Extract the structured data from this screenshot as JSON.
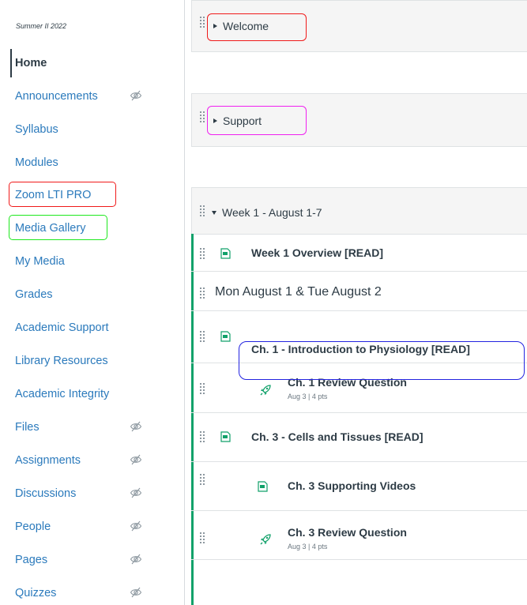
{
  "nav": {
    "term": "Summer II 2022",
    "items": [
      {
        "label": "Home",
        "active": true,
        "hidden": false
      },
      {
        "label": "Announcements",
        "active": false,
        "hidden": true
      },
      {
        "label": "Syllabus",
        "active": false,
        "hidden": false
      },
      {
        "label": "Modules",
        "active": false,
        "hidden": false
      },
      {
        "label": "Zoom LTI PRO",
        "active": false,
        "hidden": false
      },
      {
        "label": "Media Gallery",
        "active": false,
        "hidden": false
      },
      {
        "label": "My Media",
        "active": false,
        "hidden": false
      },
      {
        "label": "Grades",
        "active": false,
        "hidden": false
      },
      {
        "label": "Academic Support",
        "active": false,
        "hidden": false
      },
      {
        "label": "Library Resources",
        "active": false,
        "hidden": false
      },
      {
        "label": "Academic Integrity",
        "active": false,
        "hidden": false
      },
      {
        "label": "Files",
        "active": false,
        "hidden": true
      },
      {
        "label": "Assignments",
        "active": false,
        "hidden": true
      },
      {
        "label": "Discussions",
        "active": false,
        "hidden": true
      },
      {
        "label": "People",
        "active": false,
        "hidden": true
      },
      {
        "label": "Pages",
        "active": false,
        "hidden": true
      },
      {
        "label": "Quizzes",
        "active": false,
        "hidden": true
      }
    ]
  },
  "modules": [
    {
      "title": "Welcome",
      "expanded": false
    },
    {
      "title": "Support",
      "expanded": false
    },
    {
      "title": "Week 1 - August 1-7",
      "expanded": true
    }
  ],
  "items": [
    {
      "type": "page",
      "title": "Week 1 Overview [READ]",
      "indent": 0
    },
    {
      "type": "subheader",
      "title": "Mon August 1 & Tue August 2"
    },
    {
      "type": "page",
      "title": "Ch. 1 - Introduction to Physiology [READ]",
      "indent": 0
    },
    {
      "type": "quiz",
      "title": "Ch. 1 Review Question",
      "details": "Aug 3  |  4 pts",
      "indent": 1
    },
    {
      "type": "page",
      "title": "Ch. 3 - Cells and Tissues [READ]",
      "indent": 0
    },
    {
      "type": "page",
      "title": "Ch. 3 Supporting Videos",
      "indent": 1
    },
    {
      "type": "quiz",
      "title": "Ch. 3 Review Question",
      "details": "Aug 3  |  4 pts",
      "indent": 1
    }
  ],
  "colors": {
    "link": "#2b7abc",
    "text": "#2d3b45",
    "module_rail": "#11a16a",
    "highlight_red": "#f01a1a",
    "highlight_green": "#1ee81e",
    "highlight_magenta": "#f020f0",
    "highlight_blue": "#2323e0"
  },
  "icons": {
    "hidden": "eye-slash-icon",
    "page": "document-icon",
    "quiz": "rocket-icon",
    "drag": "drag-handle-icon"
  }
}
